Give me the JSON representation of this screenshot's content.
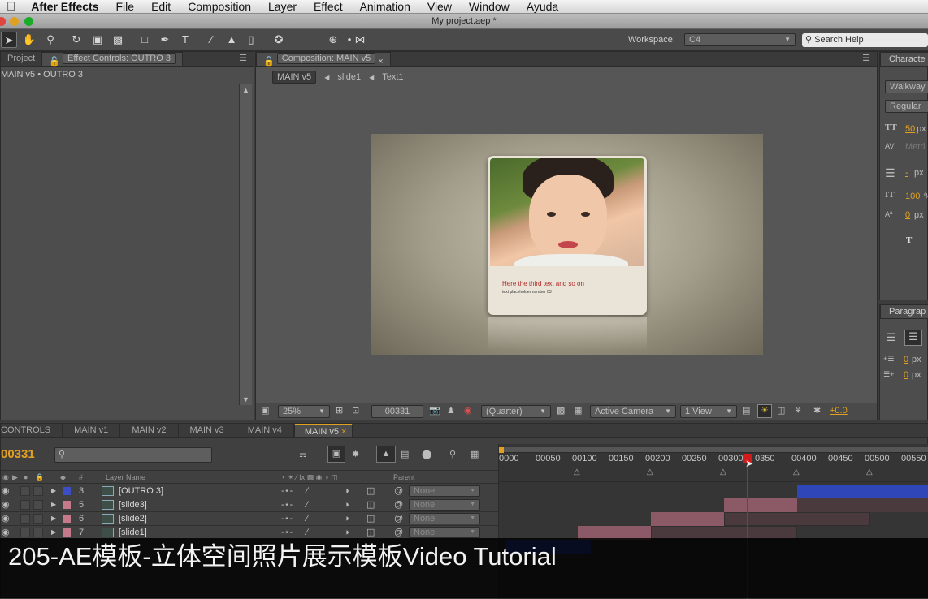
{
  "menubar": {
    "app": "After Effects",
    "items": [
      "File",
      "Edit",
      "Composition",
      "Layer",
      "Effect",
      "Animation",
      "View",
      "Window",
      "Ayuda"
    ]
  },
  "window": {
    "title": "My project.aep *"
  },
  "toolbar": {
    "workspace_label": "Workspace:",
    "workspace_value": "C4",
    "search_placeholder": "Search Help"
  },
  "left_panel": {
    "tab_project": "Project",
    "tab_effect": "Effect Controls: OUTRO 3",
    "subtitle": "MAIN v5 • OUTRO 3"
  },
  "comp_panel": {
    "tab": "Composition: MAIN v5",
    "breadcrumbs": [
      "MAIN v5",
      "slide1",
      "Text1"
    ],
    "card_heading": "Here the third text and so on",
    "card_sub": "text placeholder number 03",
    "zoom": "25%",
    "timecode": "00331",
    "resolution": "(Quarter)",
    "camera": "Active Camera",
    "views": "1 View",
    "exposure": "+0.0"
  },
  "character_panel": {
    "title": "Characte",
    "font": "Walkway",
    "style": "Regular",
    "size": "50",
    "size_unit": "px",
    "kerning": "Metri",
    "leading": "-",
    "leading_unit": "px",
    "vscale": "100",
    "vscale_unit": "%",
    "baseline": "0",
    "baseline_unit": "px",
    "t_label": "T"
  },
  "paragraph_panel": {
    "title": "Paragrap",
    "indent1": "0",
    "indent1_unit": "px",
    "indent2": "0",
    "indent2_unit": "px"
  },
  "timeline": {
    "tabs": [
      "CONTROLS",
      "MAIN v1",
      "MAIN v2",
      "MAIN v3",
      "MAIN v4",
      "MAIN v5"
    ],
    "current_time": "00331",
    "col_num": "#",
    "col_layer_name": "Layer Name",
    "col_parent": "Parent",
    "ruler": [
      "0000",
      "00050",
      "00100",
      "00150",
      "00200",
      "00250",
      "00300",
      "0350",
      "00400",
      "00450",
      "00500",
      "00550"
    ],
    "layers": [
      {
        "num": "3",
        "name": "[OUTRO 3]",
        "parent": "None",
        "label_color": "#3b4ec4"
      },
      {
        "num": "5",
        "name": "[slide3]",
        "parent": "None",
        "label_color": "#c47a8a"
      },
      {
        "num": "6",
        "name": "[slide2]",
        "parent": "None",
        "label_color": "#c47a8a"
      },
      {
        "num": "7",
        "name": "[slide1]",
        "parent": "None",
        "label_color": "#c47a8a"
      }
    ]
  },
  "caption": {
    "text": "205-AE模板-立体空间照片展示模板Video Tutorial"
  },
  "colors": {
    "accent": "#e2a021",
    "playhead": "#d21a1a",
    "bar_blue": "#2f46b8",
    "bar_pink": "#8c5a66"
  }
}
